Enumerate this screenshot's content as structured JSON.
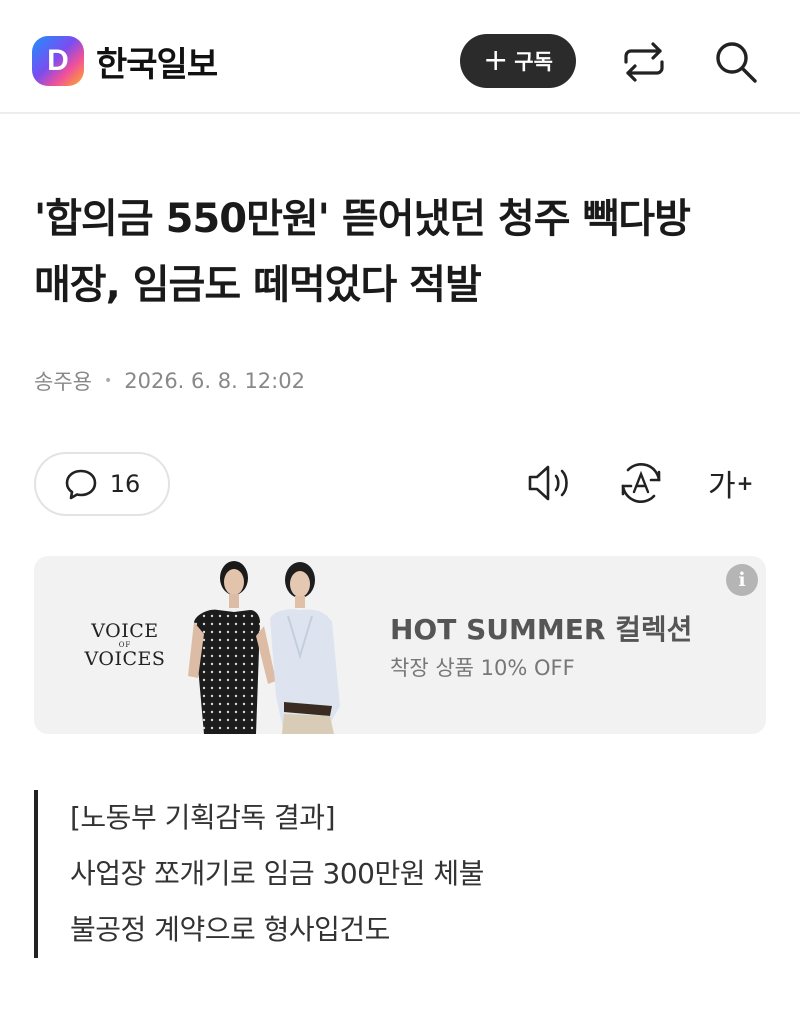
{
  "header": {
    "logo_letter": "D",
    "logo_text": "한국일보",
    "subscribe_plus": "+",
    "subscribe_label": "구독",
    "share_icon": "share-arrow-icon",
    "search_icon": "search-icon"
  },
  "article": {
    "headline_line1": "'합의금 550만원' 뜯어냈던 청주 빽다방",
    "headline_line2": "매장, 임금도 떼먹었다 적발",
    "author": "송주용",
    "separator": "•",
    "date": "2026. 6. 8. 12:02"
  },
  "tools": {
    "comment_count": "16",
    "font_size_label": "가",
    "font_size_plus": "+"
  },
  "ad": {
    "brand_line1": "VOICE",
    "brand_line2": "OF",
    "brand_line3": "VOICES",
    "title": "HOT SUMMER 컬렉션",
    "subtitle": "착장 상품 10% OFF",
    "info_label": "i"
  },
  "summary": {
    "lines": [
      "[노동부 기획감독 결과]",
      "사업장 쪼개기로 임금 300만원 체불",
      "불공정 계약으로 형사입건도"
    ]
  },
  "colors": {
    "subscribe_bg": "#2b2b2b",
    "ad_bg": "#f2f2f2",
    "summary_bar": "#222222"
  }
}
